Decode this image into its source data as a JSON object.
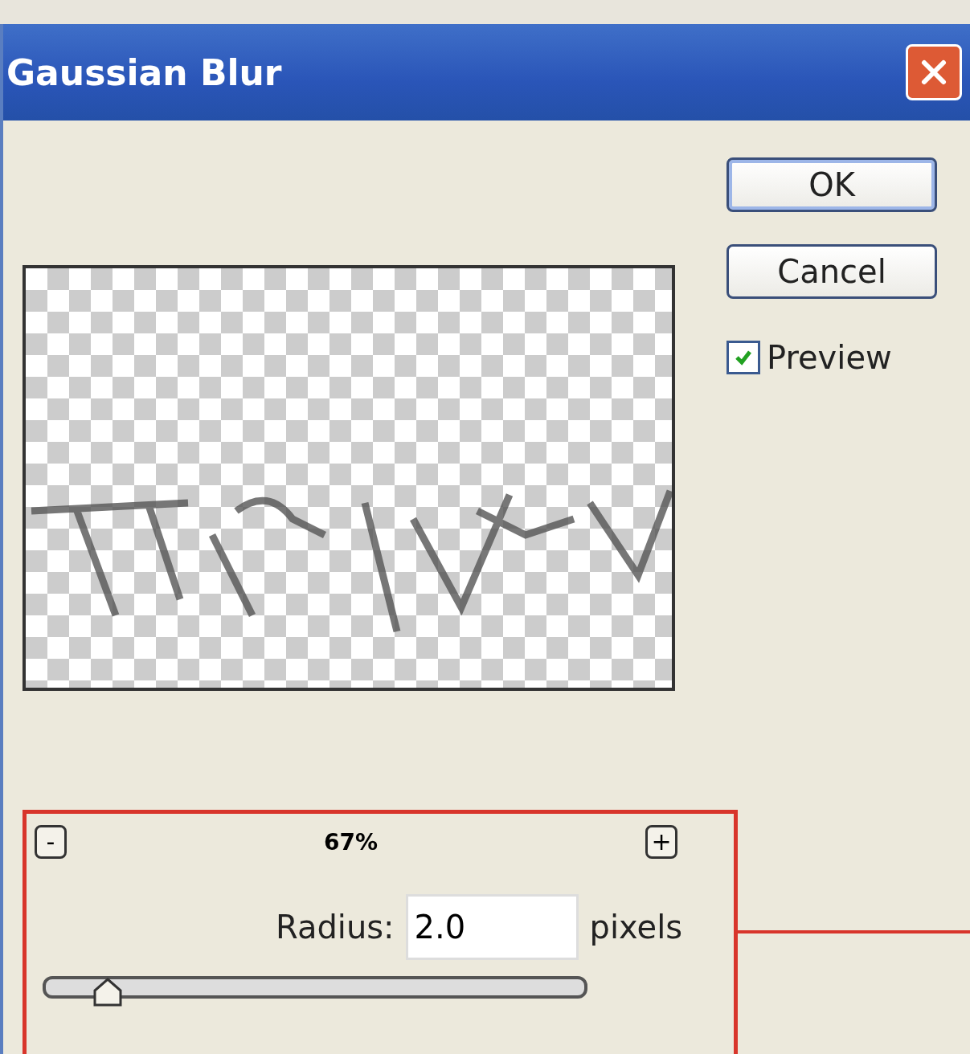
{
  "window": {
    "title": "Gaussian Blur"
  },
  "buttons": [
    {
      "label": "OK",
      "kind": "default"
    },
    {
      "label": "Cancel",
      "kind": "normal"
    }
  ],
  "preview_option": {
    "label": "Preview",
    "checked": true
  },
  "zoom": {
    "minus": "-",
    "plus": "+",
    "reading": "67%"
  },
  "radius": {
    "label": "Radius:",
    "value": "2.0",
    "unit": "pixels",
    "level": 0.1
  }
}
